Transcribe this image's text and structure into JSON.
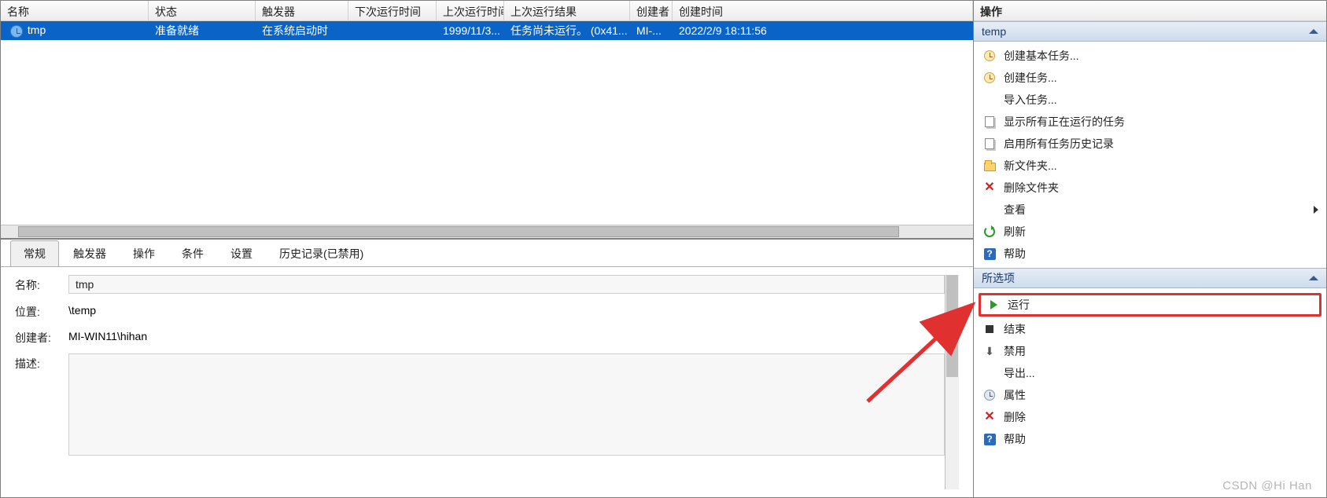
{
  "columns": {
    "name": "名称",
    "status": "状态",
    "trigger": "触发器",
    "next_run": "下次运行时间",
    "last_run": "上次运行时间",
    "last_result": "上次运行结果",
    "author": "创建者",
    "created": "创建时间"
  },
  "task": {
    "name": "tmp",
    "status": "准备就绪",
    "trigger": "在系统启动时",
    "next_run": "",
    "last_run": "1999/11/3...",
    "last_result": "任务尚未运行。 (0x41...",
    "author": "MI-...",
    "created": "2022/2/9 18:11:56"
  },
  "tabs": {
    "general": "常规",
    "triggers": "触发器",
    "actions": "操作",
    "conditions": "条件",
    "settings": "设置",
    "history": "历史记录(已禁用)"
  },
  "detail_labels": {
    "name": "名称:",
    "location": "位置:",
    "creator": "创建者:",
    "description": "描述:"
  },
  "detail_values": {
    "name": "tmp",
    "location": "\\temp",
    "creator": "MI-WIN11\\hihan",
    "description": ""
  },
  "side": {
    "header": "操作",
    "group_temp": "temp",
    "group_selected": "所选项",
    "temp_actions": {
      "create_basic": "创建基本任务...",
      "create_task": "创建任务...",
      "import": "导入任务...",
      "show_running": "显示所有正在运行的任务",
      "enable_history": "启用所有任务历史记录",
      "new_folder": "新文件夹...",
      "delete_folder": "删除文件夹",
      "view": "查看",
      "refresh": "刷新",
      "help": "帮助"
    },
    "sel_actions": {
      "run": "运行",
      "end": "结束",
      "disable": "禁用",
      "export": "导出...",
      "properties": "属性",
      "delete": "删除",
      "help": "帮助"
    }
  },
  "watermark": "CSDN @Hi Han"
}
